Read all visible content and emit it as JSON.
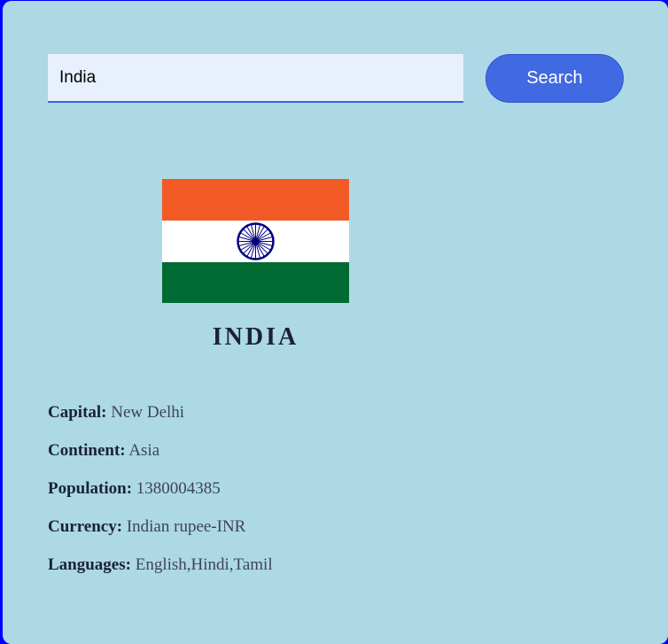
{
  "search": {
    "value": "India",
    "button_label": "Search"
  },
  "country": {
    "name": "INDIA",
    "flag_icon": "india-flag-icon",
    "flag_colors": {
      "saffron": "#f15a24",
      "white": "#ffffff",
      "green": "#006a33",
      "chakra": "#000080"
    }
  },
  "details": [
    {
      "label": "Capital:",
      "value": "New Delhi"
    },
    {
      "label": "Continent:",
      "value": "Asia"
    },
    {
      "label": "Population:",
      "value": "1380004385"
    },
    {
      "label": "Currency:",
      "value": "Indian rupee-INR"
    },
    {
      "label": "Languages:",
      "value": "English,Hindi,Tamil"
    }
  ],
  "colors": {
    "page_border": "#0000ff",
    "card_background": "#add8e6",
    "button_background": "#4169e1",
    "input_background": "#e8f0fd"
  }
}
